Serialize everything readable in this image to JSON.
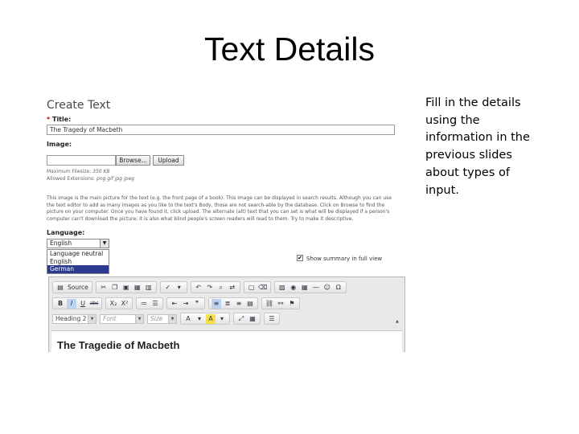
{
  "slide": {
    "title": "Text Details",
    "note": "Fill in the details using the information in the previous slides about types of input."
  },
  "form": {
    "heading": "Create Text",
    "title_required_mark": "*",
    "title_label": "Title:",
    "title_value": "The Tragedy of Macbeth",
    "image_label": "Image:",
    "browse_label": "Browse...",
    "upload_label": "Upload",
    "max_filesize_label": "Maximum Filesize:",
    "max_filesize_value": "350 KB",
    "allowed_ext_label": "Allowed Extensions:",
    "allowed_ext_value": "png gif jpg jpeg",
    "help_text": "This image is the main picture for the text (e.g. the front page of a book). This image can be displayed in search results. Although you can use the text editor to add as many images as you like to the text's Body, those are not search-able by the database. Click on Browse to find the picture on your computer. Once you have found it, click upload. The alternate (alt) text that you can set is what will be displayed if a person's computer can't download the picture; it is also what blind people's screen readers will read to them. Try to make it descriptive.",
    "language_label": "Language:",
    "language_selected": "English",
    "language_options": [
      "Language neutral",
      "English",
      "German"
    ],
    "language_highlighted_index": 2,
    "show_summary_label": "Show summary in full view",
    "show_summary_checked": "✔"
  },
  "editor": {
    "source_label": "Source",
    "format_value": "Heading 2",
    "font_placeholder": "Font",
    "size_placeholder": "Size",
    "bold": "B",
    "italic": "I",
    "underline": "U",
    "strike": "abc",
    "subscript": "X₂",
    "superscript": "X²",
    "content_heading": "The Tragedie of Macbeth"
  }
}
